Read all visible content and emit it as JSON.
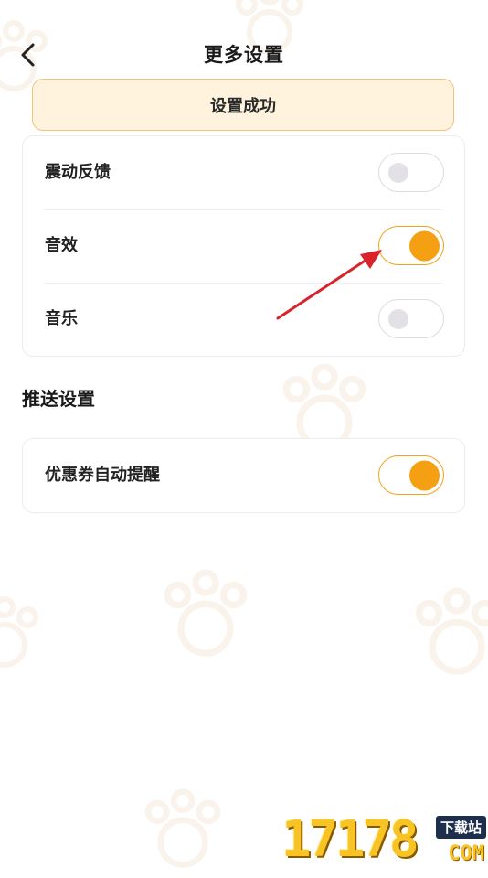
{
  "header": {
    "title": "更多设置"
  },
  "toast": {
    "text": "设置成功"
  },
  "settings": {
    "items": [
      {
        "label": "震动反馈",
        "enabled": false
      },
      {
        "label": "音效",
        "enabled": true
      },
      {
        "label": "音乐",
        "enabled": false
      }
    ]
  },
  "push": {
    "section_title": "推送设置",
    "items": [
      {
        "label": "优惠券自动提醒",
        "enabled": true
      }
    ]
  },
  "watermark": {
    "number": "17178",
    "badge": "下载站",
    "domain": "COM"
  },
  "colors": {
    "accent": "#f5a012",
    "toast_bg": "#fff3de",
    "toast_border": "#f2c27a"
  }
}
